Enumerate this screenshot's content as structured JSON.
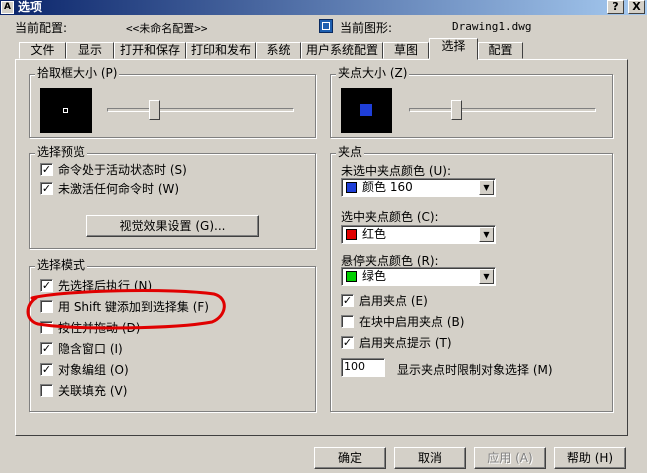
{
  "window": {
    "title": "选项",
    "help_btn": "?",
    "close_btn": "X"
  },
  "header": {
    "current_profile_label": "当前配置:",
    "current_profile_value": "<<未命名配置>>",
    "current_drawing_label": "当前图形:",
    "current_drawing_value": "Drawing1.dwg"
  },
  "tabs": [
    {
      "label": "文件"
    },
    {
      "label": "显示"
    },
    {
      "label": "打开和保存"
    },
    {
      "label": "打印和发布"
    },
    {
      "label": "系统"
    },
    {
      "label": "用户系统配置"
    },
    {
      "label": "草图"
    },
    {
      "label": "选择"
    },
    {
      "label": "配置"
    }
  ],
  "pickbox": {
    "label": "拾取框大小 (P)",
    "level": 0.25
  },
  "grip_size": {
    "label": "夹点大小 (Z)",
    "level": 0.25
  },
  "selection_preview": {
    "label": "选择预览",
    "options": [
      {
        "label": "命令处于活动状态时 (S)",
        "checked": true
      },
      {
        "label": "未激活任何命令时 (W)",
        "checked": true
      }
    ],
    "effects_button": "视觉效果设置 (G)..."
  },
  "selection_mode": {
    "label": "选择模式",
    "options": [
      {
        "label": "先选择后执行 (N)",
        "checked": true
      },
      {
        "label": "用 Shift 键添加到选择集 (F)",
        "checked": false
      },
      {
        "label": "按住并拖动 (D)",
        "checked": false
      },
      {
        "label": "隐含窗口 (I)",
        "checked": true
      },
      {
        "label": "对象编组 (O)",
        "checked": true
      },
      {
        "label": "关联填充 (V)",
        "checked": false
      }
    ]
  },
  "grips": {
    "label": "夹点",
    "unselected_label": "未选中夹点颜色 (U):",
    "unselected_value": "颜色 160",
    "unselected_color": "#1f3fd8",
    "selected_label": "选中夹点颜色 (C):",
    "selected_value": "红色",
    "selected_color": "#e00000",
    "hover_label": "悬停夹点颜色 (R):",
    "hover_value": "绿色",
    "hover_color": "#00d000",
    "options": [
      {
        "label": "启用夹点 (E)",
        "checked": true
      },
      {
        "label": "在块中启用夹点 (B)",
        "checked": false
      },
      {
        "label": "启用夹点提示 (T)",
        "checked": true
      }
    ],
    "limit_value": "100",
    "limit_label": "显示夹点时限制对象选择 (M)"
  },
  "buttons": {
    "ok": "确定",
    "cancel": "取消",
    "apply": "应用 (A)",
    "help": "帮助 (H)"
  },
  "annotation_color": "#e00000"
}
